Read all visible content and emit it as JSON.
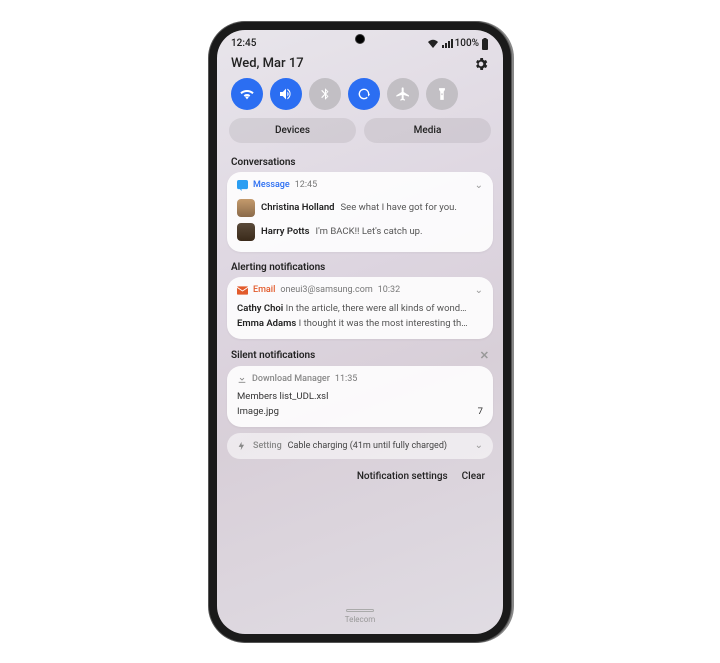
{
  "status": {
    "time": "12:45",
    "battery": "100%"
  },
  "header": {
    "date": "Wed, Mar 17"
  },
  "panel": {
    "devices": "Devices",
    "media": "Media"
  },
  "sections": {
    "conversations": "Conversations",
    "alerting": "Alerting notifications",
    "silent": "Silent notifications"
  },
  "message": {
    "app": "Message",
    "time": "12:45",
    "items": [
      {
        "sender": "Christina Holland",
        "body": "See what I have got for you."
      },
      {
        "sender": "Harry Potts",
        "body": "I'm BACK!! Let's catch up."
      }
    ]
  },
  "email": {
    "app": "Email",
    "account": "oneui3@samsung.com",
    "time": "10:32",
    "items": [
      {
        "sender": "Cathy Choi",
        "body": "In the article, there were all kinds of wond…"
      },
      {
        "sender": "Emma Adams",
        "body": "I thought it was the most interesting th…"
      }
    ]
  },
  "download": {
    "app": "Download Manager",
    "time": "11:35",
    "files": [
      {
        "name": "Members list_UDL.xsl",
        "count": ""
      },
      {
        "name": "Image.jpg",
        "count": "7"
      }
    ]
  },
  "setting": {
    "app": "Setting",
    "text": "Cable charging (41m until fully charged)"
  },
  "footer": {
    "settings": "Notification settings",
    "clear": "Clear"
  },
  "carrier": "Telecom"
}
